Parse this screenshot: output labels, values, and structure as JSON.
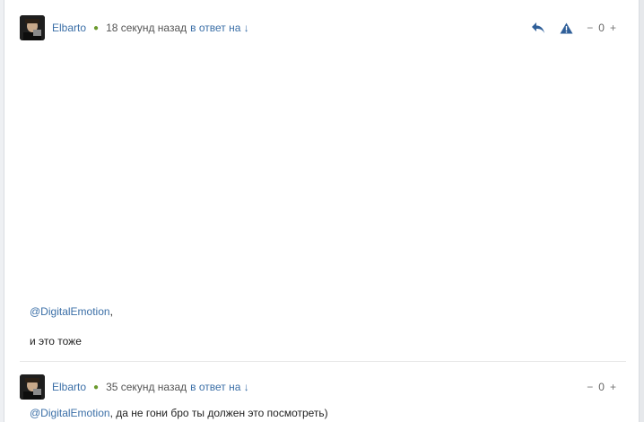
{
  "comments": [
    {
      "author": "Elbarto",
      "time": "18 секунд назад",
      "reply_link": "в ответ на ↓",
      "vote_minus": "−",
      "vote_count": "0",
      "vote_plus": "+",
      "mention": "@DigitalEmotion",
      "mention_suffix": ",",
      "line2": "и это тоже"
    },
    {
      "author": "Elbarto",
      "time": "35 секунд назад",
      "reply_link": "в ответ на ↓",
      "vote_minus": "−",
      "vote_count": "0",
      "vote_plus": "+",
      "mention": "@DigitalEmotion",
      "body": ", да не гони бро ты должен это посмотреть)"
    }
  ],
  "icons": {
    "reply": "reply-arrow-icon",
    "report": "warning-triangle-icon",
    "status": "online-dot-icon"
  },
  "colors": {
    "link": "#3b6fa7",
    "icon": "#2f5f99",
    "online_dot": "#6b9a2e"
  }
}
